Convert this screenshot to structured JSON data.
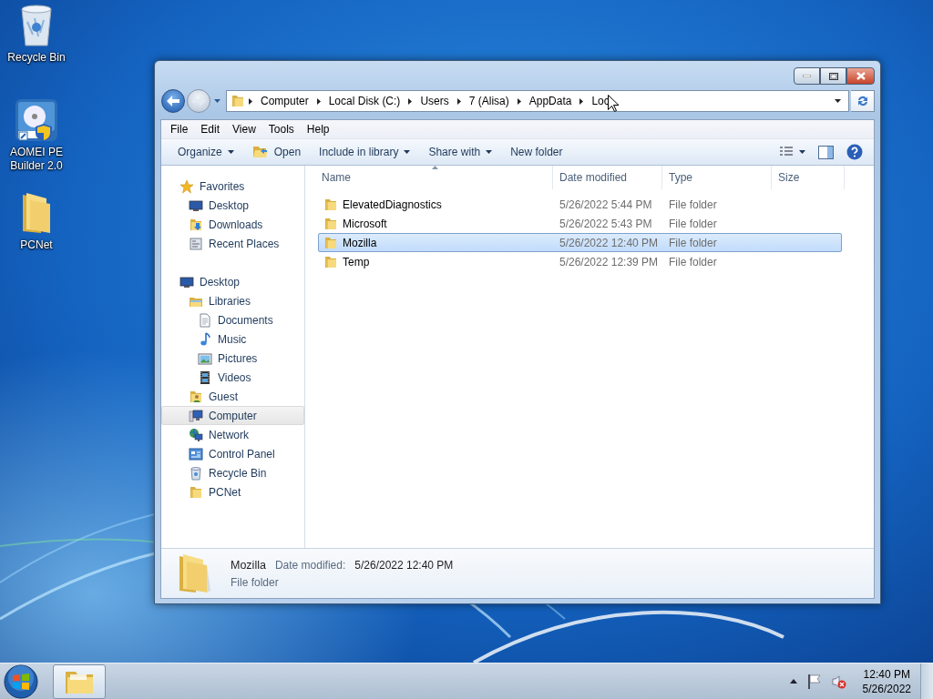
{
  "desktop_icons": [
    {
      "label": "Recycle Bin"
    },
    {
      "label": "AOMEI PE Builder 2.0"
    },
    {
      "label": "PCNet"
    }
  ],
  "window": {
    "address": {
      "crumbs": [
        "Computer",
        "Local Disk (C:)",
        "Users",
        "7 (Alisa)",
        "AppData",
        "Loc"
      ]
    },
    "menu": [
      "File",
      "Edit",
      "View",
      "Tools",
      "Help"
    ],
    "toolbar": [
      {
        "label": "Organize",
        "dropdown": true
      },
      {
        "label": "Open",
        "dropdown": false
      },
      {
        "label": "Include in library",
        "dropdown": true
      },
      {
        "label": "Share with",
        "dropdown": true
      },
      {
        "label": "New folder",
        "dropdown": false
      }
    ],
    "nav": [
      {
        "label": "Favorites",
        "selected": false,
        "children": [
          {
            "label": "Desktop",
            "selected": false
          },
          {
            "label": "Downloads",
            "selected": false
          },
          {
            "label": "Recent Places",
            "selected": false
          }
        ]
      },
      {
        "label": "Desktop",
        "selected": false,
        "children": [
          {
            "label": "Libraries",
            "selected": false,
            "children": [
              {
                "label": "Documents",
                "selected": false
              },
              {
                "label": "Music",
                "selected": false
              },
              {
                "label": "Pictures",
                "selected": false
              },
              {
                "label": "Videos",
                "selected": false
              }
            ]
          },
          {
            "label": "Guest",
            "selected": false
          },
          {
            "label": "Computer",
            "selected": true
          },
          {
            "label": "Network",
            "selected": false
          },
          {
            "label": "Control Panel",
            "selected": false
          },
          {
            "label": "Recycle Bin",
            "selected": false
          },
          {
            "label": "PCNet",
            "selected": false
          }
        ]
      }
    ],
    "columns": [
      "Name",
      "Date modified",
      "Type",
      "Size"
    ],
    "rows": [
      {
        "name": "ElevatedDiagnostics",
        "date": "5/26/2022 5:44 PM",
        "type": "File folder",
        "selected": false
      },
      {
        "name": "Microsoft",
        "date": "5/26/2022 5:43 PM",
        "type": "File folder",
        "selected": false
      },
      {
        "name": "Mozilla",
        "date": "5/26/2022 12:40 PM",
        "type": "File folder",
        "selected": true
      },
      {
        "name": "Temp",
        "date": "5/26/2022 12:39 PM",
        "type": "File folder",
        "selected": false
      }
    ],
    "details": {
      "name": "Mozilla",
      "date_label": "Date modified:",
      "date": "5/26/2022 12:40 PM",
      "type": "File folder"
    }
  },
  "taskbar": {
    "time": "12:40 PM",
    "date": "5/26/2022"
  }
}
